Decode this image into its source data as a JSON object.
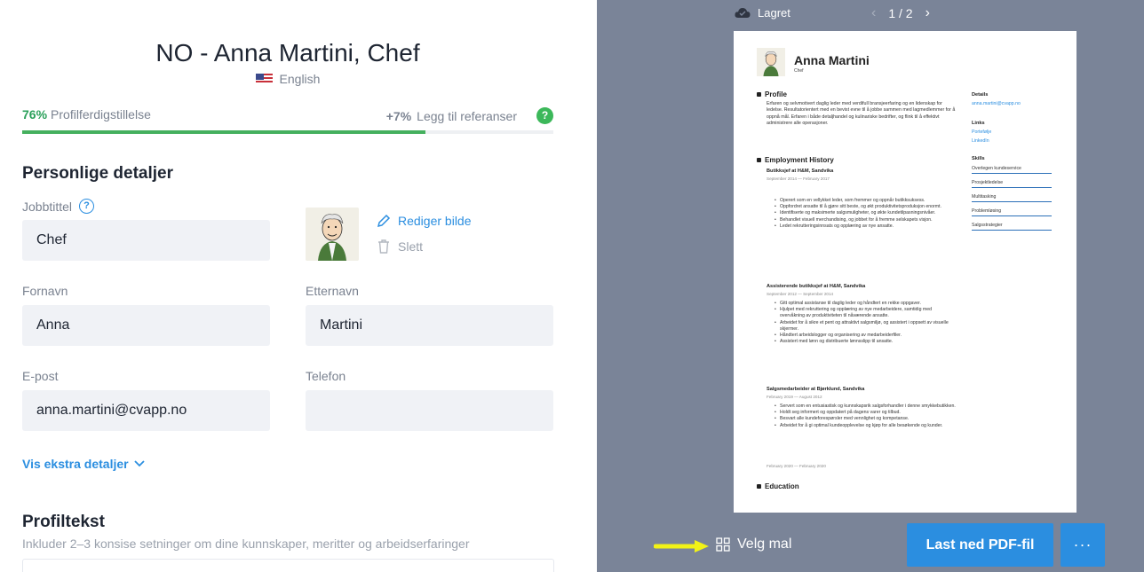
{
  "header": {
    "title": "NO - Anna Martini, Chef",
    "language": "English"
  },
  "progress": {
    "percent_text": "76%",
    "percent_value": 76,
    "label": "Profilferdigstillelse",
    "hint_increment": "+7%",
    "hint_label": "Legg til referanser",
    "help_glyph": "?"
  },
  "personal": {
    "section_title": "Personlige detaljer",
    "job_title_label": "Jobbtittel",
    "job_title_value": "Chef",
    "edit_photo_label": "Rediger bilde",
    "delete_photo_label": "Slett",
    "first_name_label": "Fornavn",
    "first_name_value": "Anna",
    "last_name_label": "Etternavn",
    "last_name_value": "Martini",
    "email_label": "E-post",
    "email_value": "anna.martini@cvapp.no",
    "phone_label": "Telefon",
    "phone_value": "",
    "more_details_label": "Vis ekstra detaljer"
  },
  "profile": {
    "section_title": "Profiltekst",
    "hint": "Inkluder 2–3 konsise setninger om dine kunnskaper, meritter og arbeidserfaringer"
  },
  "preview": {
    "saved_label": "Lagret",
    "pager": "1 / 2",
    "choose_template_label": "Velg mal",
    "download_label": "Last ned PDF-fil",
    "more_label": "···",
    "accent_color": "#2b8ee0",
    "background_color": "#7a8498"
  },
  "resume": {
    "name": "Anna Martini",
    "role": "Chef",
    "profile_heading": "Profile",
    "profile_text": "Erfaren og selvmotivert daglig leder med verdifull bransjeerfaring og en lidenskap for ledelse. Resultatorientert med en bevist evne til å jobbe sammen med lagmedlemmer for å oppnå mål. Erfaren i både detaljhandel og kulinariske bedrifter, og flink til å effektivt administrere alle operasjoner.",
    "employment_heading": "Employment History",
    "jobs": [
      {
        "title": "Butikksjef at H&M, Sandvika",
        "date": "September 2014 — February 2017",
        "bullets": [
          "Operert som en vellykket leder, som fremmer og oppnår butikksuksess.",
          "Oppfordret ansatte til å gjøre sitt beste, og økt produktivitetsproduksjon enormt.",
          "Identifiserte og maksimerte salgsmuligheter, og økte kundetilpasningsnivåer.",
          "Behandlet visuell merchandising, og jobbet for å fremme selskapets visjon.",
          "Ledet rekrutteringsinnsats og opplæring av nye ansatte."
        ]
      },
      {
        "title": "Assisterende butikksjef at H&M, Sandvika",
        "date": "September 2012 — September 2014",
        "bullets": [
          "Gitt optimal assistanse til daglig leder og håndtert en rekke oppgaver.",
          "Hjulpet med rekruttering og opplæring av nye medarbeidere, samtidig med overvåkning av produktiviteten til nåværende ansatte.",
          "Arbeidet for å sikre et pent og attraktivt salgsmiljø, og assistert i oppsett av visuelle skjermer.",
          "Håndtert arbeidslogger og organisering av medarbeiderfiler.",
          "Assistert med lønn og distribuerte lønnsslipp til ansatte."
        ]
      },
      {
        "title": "Salgsmedarbeider at Bjørklund, Sandvika",
        "date": "February 2019 — August 2012",
        "bullets": [
          "Servert som en entusiastisk og kunnskapsrik salgsforhandler i denne smykkebutikken.",
          "Holdt seg informert og oppdatert på dagens varer og tilbud.",
          "Besvart alle kundeforespørsler med vennlighet og kompetanse.",
          "Arbeidet for å gi optimal kundeopplevelse og kjøp for alle besøkende og kunder."
        ]
      }
    ],
    "extra_date": "February 2020 — February 2020",
    "education_heading": "Education",
    "details_heading": "Details",
    "details_email": "anna.martini@cvapp.no",
    "links_heading": "Links",
    "links": [
      "Portefølje",
      "LinkedIn"
    ],
    "skills_heading": "Skills",
    "skills": [
      "Overlegen kundeservice",
      "Prosjektledelse",
      "Multitasking",
      "Problemløsing",
      "Salgsstrategier"
    ]
  }
}
